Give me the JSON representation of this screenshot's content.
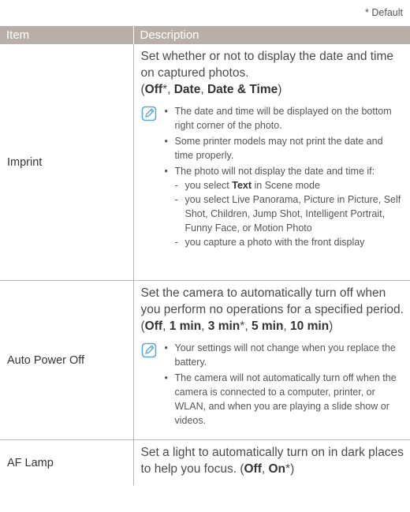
{
  "default_note": "* Default",
  "header": {
    "item": "Item",
    "description": "Description"
  },
  "imprint": {
    "item": "Imprint",
    "text": "Set whether or not to display the date and time on captured photos.",
    "options": {
      "open": "(",
      "o1": "Off",
      "o1_mark": "*, ",
      "o2": "Date",
      "sep2": ", ",
      "o3": "Date & Time",
      "close": ")"
    },
    "notes": {
      "n1": "The date and time will be displayed on the bottom right corner of the photo.",
      "n2": "Some printer models may not print the date and time properly.",
      "n3": "The photo will not display the date and time if:",
      "s1_pre": "you select ",
      "s1_bold": "Text",
      "s1_post": " in Scene mode",
      "s2": "you select Live Panorama, Picture in Picture, Self Shot, Children, Jump Shot, Intelligent Portrait, Funny Face, or Motion Photo",
      "s3": "you capture a photo with the front display"
    }
  },
  "auto_power_off": {
    "item": "Auto Power Off",
    "text": "Set the camera to automatically turn off when you perform no operations for a specified period. ",
    "options": {
      "open": "(",
      "o1": "Off",
      "sep1": ", ",
      "o2": "1 min",
      "sep2": ", ",
      "o3": "3 min",
      "o3_mark": "*, ",
      "o4": "5 min",
      "sep4": ", ",
      "o5": "10 min",
      "close": ")"
    },
    "notes": {
      "n1": "Your settings will not change when you replace the battery.",
      "n2": "The camera will not automatically turn off when the camera is connected to a computer, printer, or WLAN, and when you are playing a slide show or videos."
    }
  },
  "af_lamp": {
    "item": "AF Lamp",
    "text": "Set a light to automatically turn on in dark places to help you focus. ",
    "options": {
      "open": "(",
      "o1": "Off",
      "sep1": ", ",
      "o2": "On",
      "o2_mark": "*",
      "close": ")"
    }
  },
  "icons": {
    "note": "note-pencil-icon"
  },
  "colors": {
    "header_bg": "#b8b0a8",
    "rule": "#bdb6ae",
    "icon": "#5aa9d6"
  }
}
